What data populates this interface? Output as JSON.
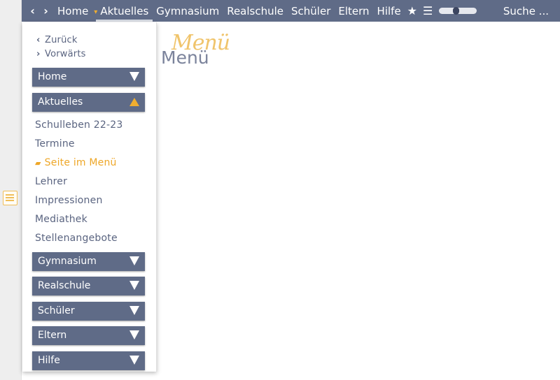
{
  "topbar": {
    "back_arrow": "‹",
    "forward_arrow": "›",
    "items": [
      "Home",
      "Aktuelles",
      "Gymnasium",
      "Realschule",
      "Schüler",
      "Eltern",
      "Hilfe"
    ],
    "caret": "▾",
    "star": "★",
    "menu": "☰",
    "slider_level": 0.45,
    "search_label": "Suche ..."
  },
  "logo": {
    "script": "Menü",
    "text": "Menü"
  },
  "panel": {
    "back_label": "Zurück",
    "forward_label": "Vorwärts",
    "sections": [
      "Home",
      "Aktuelles",
      "Gymnasium",
      "Realschule",
      "Schüler",
      "Eltern",
      "Hilfe"
    ],
    "expanded_section": "Aktuelles",
    "aktuelles_items": [
      "Schulleben 22-23",
      "Termine",
      "Seite im Menü",
      "Lehrer",
      "Impressionen",
      "Mediathek",
      "Stellenangebote"
    ],
    "active_item": "Seite im Menü",
    "active_marker": "▰"
  },
  "colors": {
    "bar": "#5f6b87",
    "accent": "#f0ae30",
    "link": "#5a6480",
    "gutter": "#eeeeee"
  }
}
